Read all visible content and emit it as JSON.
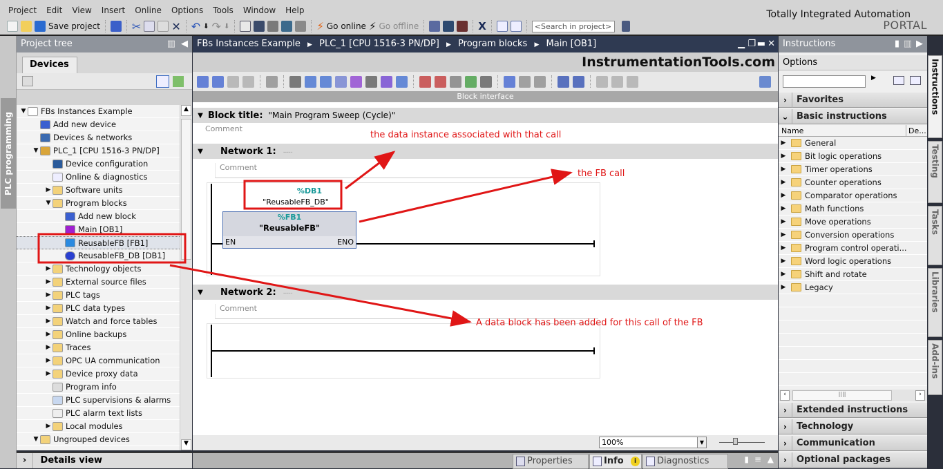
{
  "menubar": [
    "Project",
    "Edit",
    "View",
    "Insert",
    "Online",
    "Options",
    "Tools",
    "Window",
    "Help"
  ],
  "toolbar": {
    "save_project": "Save project",
    "go_online": "Go online",
    "go_offline": "Go offline",
    "search_placeholder": "<Search in project>"
  },
  "brand": {
    "line1": "Totally Integrated Automation",
    "line2": "PORTAL"
  },
  "left_vtab": "PLC programming",
  "project_tree": {
    "title": "Project tree",
    "tab": "Devices",
    "items": [
      {
        "label": "FBs Instances Example",
        "level": 0,
        "expander": "open",
        "icon": "project-icon"
      },
      {
        "label": "Add new device",
        "level": 1,
        "expander": "",
        "icon": "add-device-icon"
      },
      {
        "label": "Devices & networks",
        "level": 1,
        "expander": "",
        "icon": "network-icon"
      },
      {
        "label": "PLC_1 [CPU 1516-3 PN/DP]",
        "level": 1,
        "expander": "open",
        "icon": "plc-icon"
      },
      {
        "label": "Device configuration",
        "level": 2,
        "expander": "",
        "icon": "device-config-icon"
      },
      {
        "label": "Online & diagnostics",
        "level": 2,
        "expander": "",
        "icon": "diagnostics-icon"
      },
      {
        "label": "Software units",
        "level": 2,
        "expander": "closed",
        "icon": "folder-icon"
      },
      {
        "label": "Program blocks",
        "level": 2,
        "expander": "open",
        "icon": "folder-icon"
      },
      {
        "label": "Add new block",
        "level": 3,
        "expander": "",
        "icon": "add-block-icon"
      },
      {
        "label": "Main [OB1]",
        "level": 3,
        "expander": "",
        "icon": "ob-block-icon"
      },
      {
        "label": "ReusableFB [FB1]",
        "level": 3,
        "expander": "",
        "icon": "fb-block-icon",
        "selected": true
      },
      {
        "label": "ReusableFB_DB [DB1]",
        "level": 3,
        "expander": "",
        "icon": "db-block-icon"
      },
      {
        "label": "Technology objects",
        "level": 2,
        "expander": "closed",
        "icon": "folder-icon"
      },
      {
        "label": "External source files",
        "level": 2,
        "expander": "closed",
        "icon": "folder-icon"
      },
      {
        "label": "PLC tags",
        "level": 2,
        "expander": "closed",
        "icon": "folder-icon"
      },
      {
        "label": "PLC data types",
        "level": 2,
        "expander": "closed",
        "icon": "folder-icon"
      },
      {
        "label": "Watch and force tables",
        "level": 2,
        "expander": "closed",
        "icon": "folder-icon"
      },
      {
        "label": "Online backups",
        "level": 2,
        "expander": "closed",
        "icon": "folder-icon"
      },
      {
        "label": "Traces",
        "level": 2,
        "expander": "closed",
        "icon": "folder-icon"
      },
      {
        "label": "OPC UA communication",
        "level": 2,
        "expander": "closed",
        "icon": "folder-icon"
      },
      {
        "label": "Device proxy data",
        "level": 2,
        "expander": "closed",
        "icon": "folder-icon"
      },
      {
        "label": "Program info",
        "level": 2,
        "expander": "",
        "icon": "program-info-icon"
      },
      {
        "label": "PLC supervisions & alarms",
        "level": 2,
        "expander": "",
        "icon": "alarms-icon"
      },
      {
        "label": "PLC alarm text lists",
        "level": 2,
        "expander": "",
        "icon": "text-list-icon"
      },
      {
        "label": "Local modules",
        "level": 2,
        "expander": "closed",
        "icon": "folder-icon"
      },
      {
        "label": "Ungrouped devices",
        "level": 1,
        "expander": "open",
        "icon": "folder-icon"
      }
    ],
    "details_view": "Details view"
  },
  "editor": {
    "breadcrumb": [
      "FBs Instances Example",
      "PLC_1 [CPU 1516-3 PN/DP]",
      "Program blocks",
      "Main [OB1]"
    ],
    "watermark": "InstrumentationTools.com",
    "block_interface": "Block interface",
    "block_title_label": "Block title:",
    "block_title_value": "\"Main Program Sweep (Cycle)\"",
    "comment": "Comment",
    "networks": [
      {
        "label": "Network 1:",
        "dots": ".....",
        "comment": "Comment",
        "instance_db_address": "%DB1",
        "instance_db_name": "\"ReusableFB_DB\"",
        "fb_address": "%FB1",
        "fb_name": "\"ReusableFB\"",
        "en": "EN",
        "eno": "ENO"
      },
      {
        "label": "Network 2:",
        "dots": ".....",
        "comment": "Comment"
      }
    ],
    "zoom": "100%"
  },
  "annotations": {
    "instance": "the data instance associated with that call",
    "fb_call": "the FB call",
    "db_added": "A data block has been added for this call of the FB",
    "color": "#e01616"
  },
  "bottom_tabs": [
    "Properties",
    "Info",
    "Diagnostics"
  ],
  "instructions": {
    "title": "Instructions",
    "options": "Options",
    "favorites": "Favorites",
    "basic": "Basic instructions",
    "col_name": "Name",
    "col_desc": "De...",
    "items": [
      "General",
      "Bit logic operations",
      "Timer operations",
      "Counter operations",
      "Comparator operations",
      "Math functions",
      "Move operations",
      "Conversion operations",
      "Program control operati...",
      "Word logic operations",
      "Shift and rotate",
      "Legacy"
    ],
    "sections": [
      "Extended instructions",
      "Technology",
      "Communication",
      "Optional packages"
    ]
  },
  "right_tabs": [
    "Instructions",
    "Testing",
    "Tasks",
    "Libraries",
    "Add-ins"
  ]
}
